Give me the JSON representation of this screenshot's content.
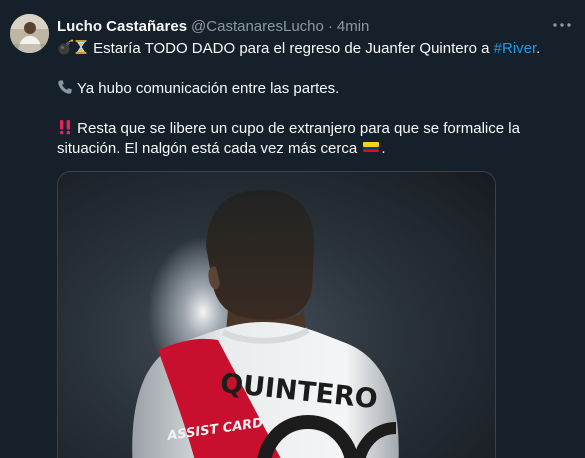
{
  "tweet": {
    "display_name": "Lucho Castañares",
    "handle": "@CastanaresLucho",
    "separator": "·",
    "time": "4min",
    "lines": {
      "p1_text": " Estaría TODO DADO para el regreso de Juanfer Quintero a ",
      "p1_hashtag": "#River",
      "p1_end": ".",
      "p2_text": " Ya hubo comunicación entre las partes.",
      "p3_text": " Resta que se libere un cupo de extranjero para que se formalice la situación. El nalgón está cada vez más cerca ",
      "p3_end": "."
    },
    "icons": {
      "p1": [
        "bomb-emoji",
        "hourglass-emoji"
      ],
      "p2": [
        "telephone-emoji"
      ],
      "p3_start": [
        "double-exclamation-emoji"
      ],
      "p3_end": [
        "colombia-flag-emoji"
      ],
      "menu": "more-options-icon"
    },
    "media": {
      "jersey_name": "QUINTERO",
      "sponsor_text": "ASSIST CARD"
    },
    "colors": {
      "background": "#15202b",
      "text": "#f7f9f9",
      "secondary_text": "#8b98a5",
      "link": "#1d9bf0",
      "jersey_band": "#c8102e"
    }
  }
}
